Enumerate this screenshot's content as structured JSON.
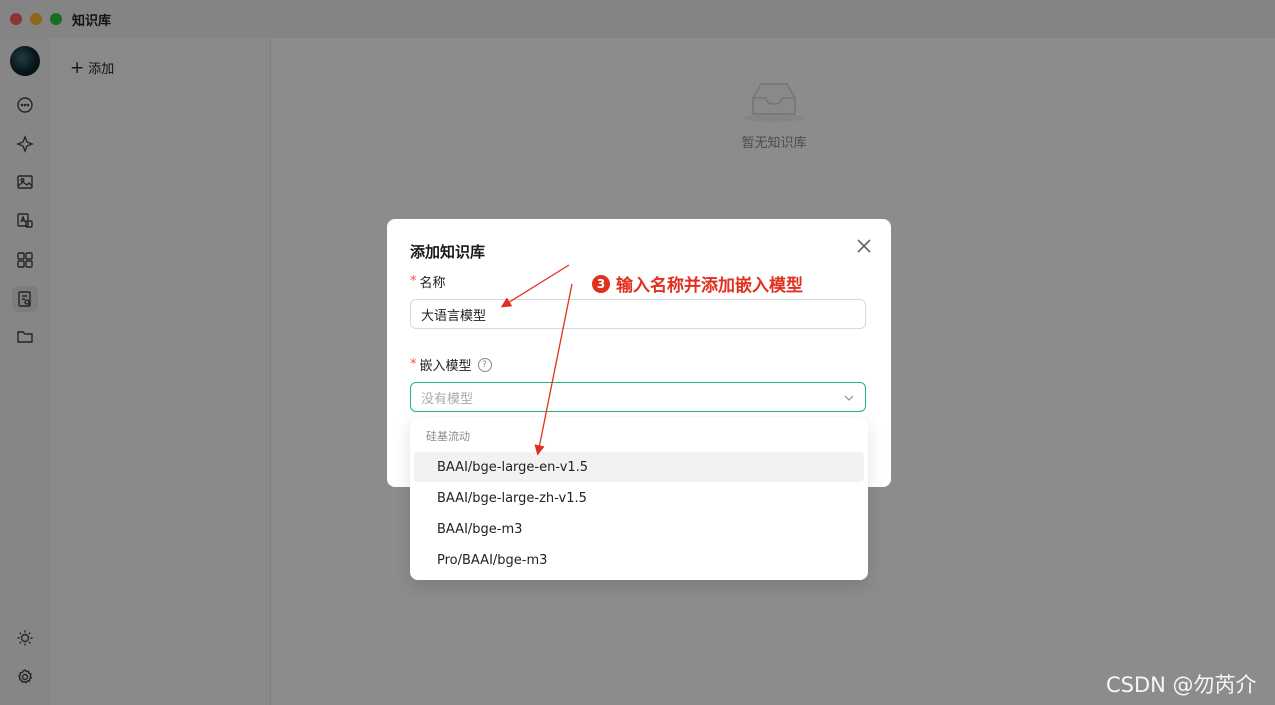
{
  "window": {
    "title": "知识库"
  },
  "sidebar": {
    "icons": [
      "chat-icon",
      "sparkle-icon",
      "image-icon",
      "translate-icon",
      "apps-icon",
      "knowledge-icon",
      "folder-icon"
    ],
    "bottom_icons": [
      "sun-icon",
      "settings-icon"
    ]
  },
  "kb_panel": {
    "add_label": "添加"
  },
  "main": {
    "empty_text": "暂无知识库"
  },
  "modal": {
    "title": "添加知识库",
    "name_label": "名称",
    "name_value": "大语言模型",
    "embed_label": "嵌入模型",
    "embed_placeholder": "没有模型"
  },
  "dropdown": {
    "group": "硅基流动",
    "options": [
      "BAAI/bge-large-en-v1.5",
      "BAAI/bge-large-zh-v1.5",
      "BAAI/bge-m3",
      "Pro/BAAI/bge-m3"
    ],
    "hovered_index": 0
  },
  "annotation": {
    "number": "3",
    "text": "输入名称并添加嵌入模型",
    "color": "#e0301e"
  },
  "watermark": "CSDN @勿芮介",
  "colors": {
    "accent": "#22b573",
    "required": "#ff4d4f"
  }
}
